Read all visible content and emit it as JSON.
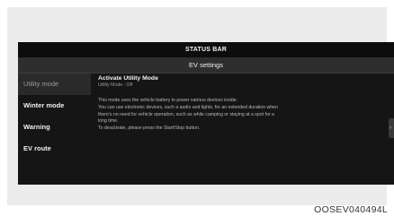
{
  "screen": {
    "status_bar": "STATUS BAR",
    "title": "EV settings"
  },
  "sidebar": {
    "items": [
      {
        "label": "Utility mode",
        "selected": true
      },
      {
        "label": "Winter mode",
        "selected": false
      },
      {
        "label": "Warning",
        "selected": false
      },
      {
        "label": "EV route",
        "selected": false
      }
    ]
  },
  "detail": {
    "title": "Activate Utility Mode",
    "status": "Utility Mode : Off",
    "description_lines": [
      "This mode uses the vehicle battery to power various devices inside.",
      "You can use electronic devices, such a audio and lights, for an extended duration when",
      "there's no need for vehicle operation, such as while camping or staying at a spot for a",
      "long time.",
      "To deactivate, please press the Start/Stop button."
    ]
  },
  "scroll_handle_glyph": "›",
  "caption": "OOSEV040494L"
}
